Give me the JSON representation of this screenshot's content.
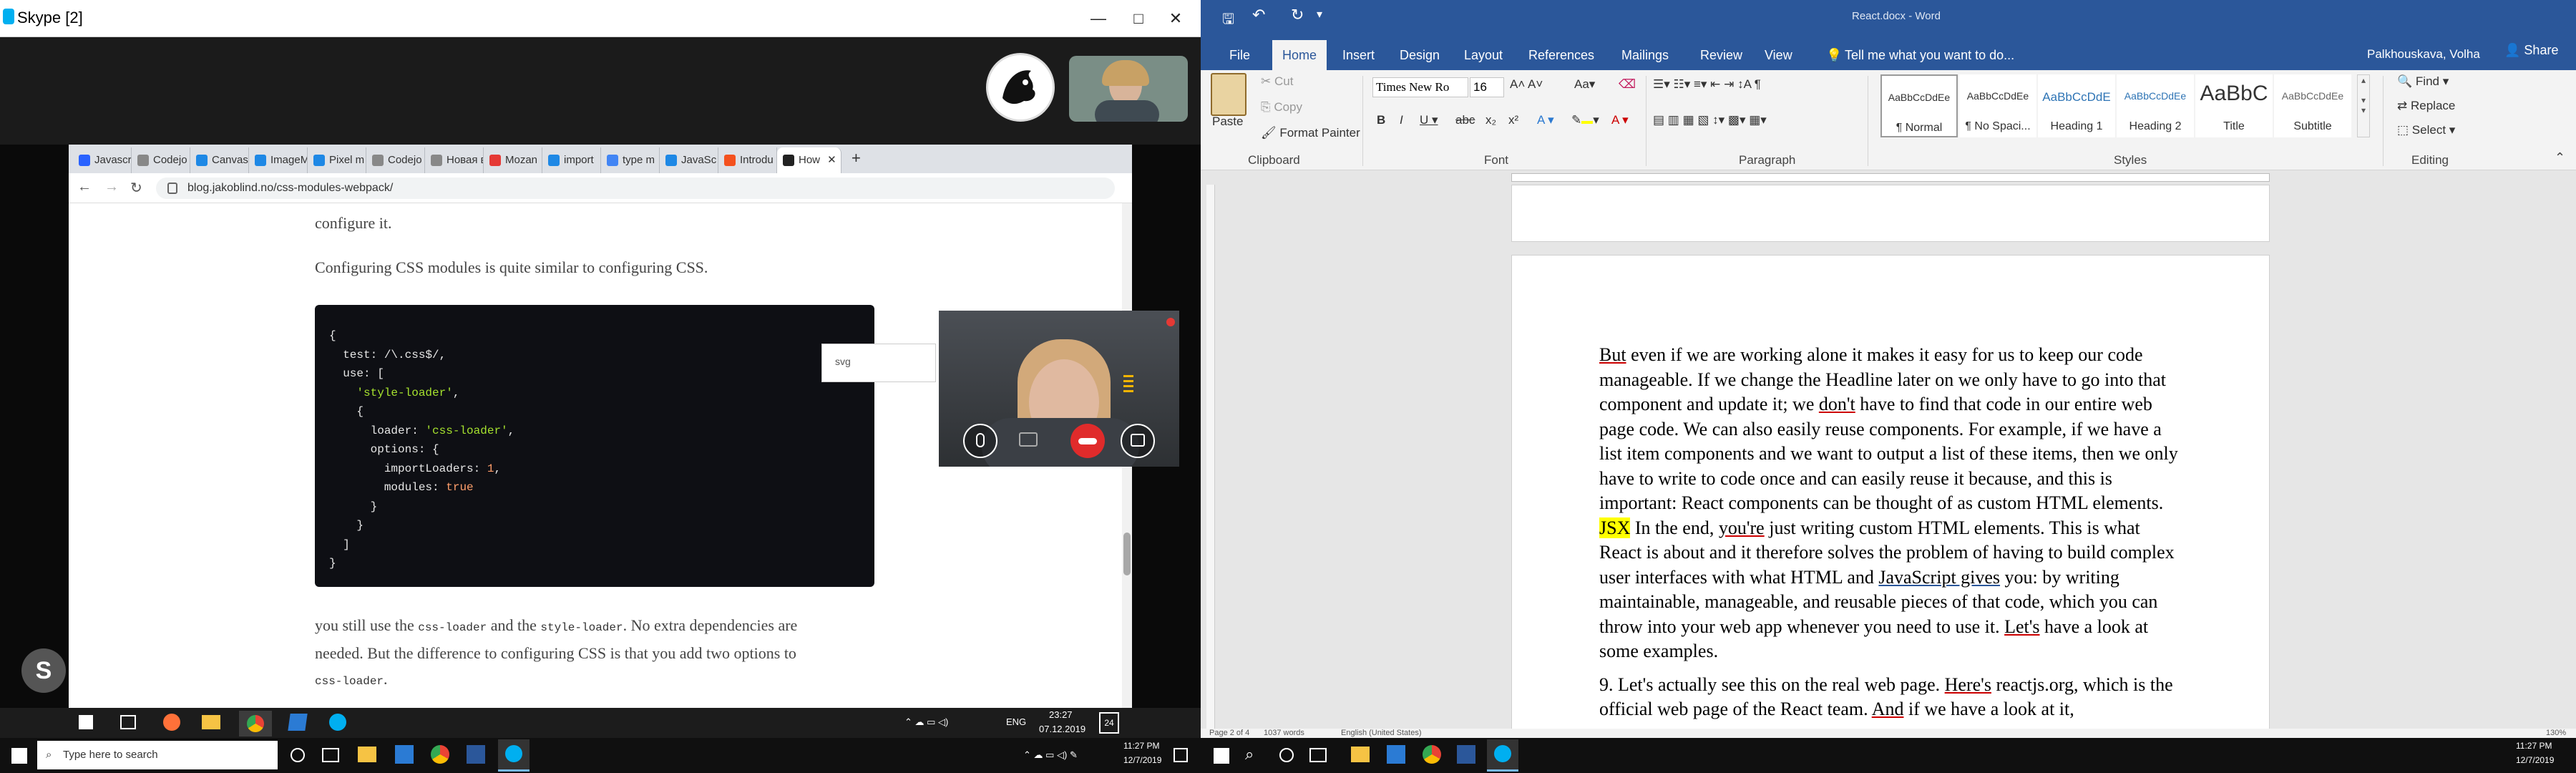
{
  "skype": {
    "title": "Skype [2]",
    "controls": {
      "minimize": "—",
      "maximize": "□",
      "close": "✕"
    }
  },
  "browser": {
    "tabs": [
      {
        "label": "Javascri",
        "color": "#2962ff"
      },
      {
        "label": "Codejo",
        "color": "#888"
      },
      {
        "label": "Canvas",
        "color": "#1e88e5"
      },
      {
        "label": "ImageM",
        "color": "#1e88e5"
      },
      {
        "label": "Pixel m",
        "color": "#1e88e5"
      },
      {
        "label": "Codejo",
        "color": "#888"
      },
      {
        "label": "Новая вкла",
        "color": "#888"
      },
      {
        "label": "Mozan",
        "color": "#e53935"
      },
      {
        "label": "import",
        "color": "#1e88e5"
      },
      {
        "label": "type m",
        "color": "#4285f4"
      },
      {
        "label": "JavaSc",
        "color": "#1e88e5"
      },
      {
        "label": "Introdu",
        "color": "#f4511e"
      }
    ],
    "active_tab": {
      "label": "How"
    },
    "url": "blog.jakoblind.no/css-modules-webpack/",
    "tooltip": "svg",
    "content": {
      "para_top_partial": "configure it.",
      "para1": "Configuring CSS modules is quite similar to configuring CSS.",
      "code_lines": [
        "{",
        "  test: /\\.css$/,",
        "  use: [",
        "    'style-loader',",
        "    {",
        "      loader: 'css-loader',",
        "      options: {",
        "        importLoaders: 1,",
        "        modules: true",
        "      }",
        "    }",
        "  ]",
        "}"
      ],
      "para2_a": "you still use the ",
      "para2_code1": "css-loader",
      "para2_b": " and the ",
      "para2_code2": "style-loader",
      "para2_c": ". No extra dependencies are",
      "para2_line2": "needed. But the difference to configuring CSS is that you add two options to",
      "para2_code3": "css-loader",
      "para2_end": "."
    }
  },
  "inner_taskbar": {
    "lang": "ENG",
    "time": "23:27",
    "date": "07.12.2019",
    "badge": "24"
  },
  "word": {
    "title": "React.docx - Word",
    "user": "Palkhouskava, Volha",
    "share": "Share",
    "tell_me": "Tell me what you want to do...",
    "tabs": [
      "File",
      "Home",
      "Insert",
      "Design",
      "Layout",
      "References",
      "Mailings",
      "Review",
      "View"
    ],
    "clipboard": {
      "paste": "Paste",
      "cut": "Cut",
      "copy": "Copy",
      "format_painter": "Format Painter",
      "label": "Clipboard"
    },
    "font": {
      "name": "Times New Ro",
      "size": "16",
      "label": "Font"
    },
    "paragraph_label": "Paragraph",
    "styles": [
      {
        "preview": "AaBbCcDdEe",
        "name": "¶ Normal"
      },
      {
        "preview": "AaBbCcDdEe",
        "name": "¶ No Spaci..."
      },
      {
        "preview": "AaBbCcDdE",
        "name": "Heading 1"
      },
      {
        "preview": "AaBbCcDdEe",
        "name": "Heading 2"
      },
      {
        "preview": "AaBbC",
        "name": "Title"
      },
      {
        "preview": "AaBbCcDdEe",
        "name": "Subtitle"
      }
    ],
    "styles_label": "Styles",
    "editing": {
      "find": "Find",
      "replace": "Replace",
      "select": "Select",
      "label": "Editing"
    },
    "doc": {
      "p1": [
        {
          "t": "But",
          "c": "u"
        },
        {
          "t": " even if we are working alone it makes it easy for us to keep our code manageable. If we change the Headline later on we only have to go into that component and update it; we "
        },
        {
          "t": "don't",
          "c": "u"
        },
        {
          "t": " have to find that code in our entire web page code. We can also easily reuse components. For example, if we have a list item components and we want to output a list of these items, then we only have to write to code once and can easily reuse it because, and this is important: React components can be thought of as custom HTML elements. "
        },
        {
          "t": "JSX",
          "c": "hl"
        },
        {
          "t": " In the end, "
        },
        {
          "t": "you're",
          "c": "u"
        },
        {
          "t": " just writing custom HTML elements. This is what React is about and it therefore solves the problem of having to build complex user interfaces with what HTML and "
        },
        {
          "t": "JavaScript  gives",
          "c": "ub"
        },
        {
          "t": " you: by writing maintainable, manageable, and reusable pieces of that code, which you can throw into your web app whenever you need to use it. "
        },
        {
          "t": "Let's",
          "c": "u"
        },
        {
          "t": " have a look at some examples."
        }
      ],
      "p2": [
        {
          "t": "9. Let's actually see this on the real web page. "
        },
        {
          "t": "Here's",
          "c": "u"
        },
        {
          "t": " reactjs.org, which is the official web page of the React team. "
        },
        {
          "t": "And",
          "c": "u"
        },
        {
          "t": " if we have a look at it,"
        }
      ]
    },
    "status": {
      "page": "Page 2 of 4",
      "words": "1037 words",
      "lang": "English (United States)",
      "zoom": "130%"
    }
  },
  "taskbar_left": {
    "search": "Type here to search",
    "time": "11:27 PM",
    "date": "12/7/2019"
  },
  "taskbar_right": {
    "time": "11:27 PM",
    "date": "12/7/2019"
  }
}
